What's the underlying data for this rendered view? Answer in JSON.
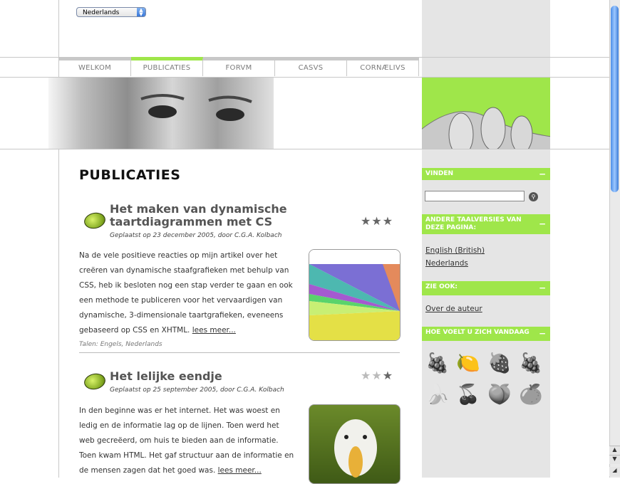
{
  "language_select": {
    "value": "Nederlands"
  },
  "nav": [
    {
      "label": "WELKOM",
      "active": false
    },
    {
      "label": "PUBLICATIES",
      "active": true
    },
    {
      "label": "FORVM",
      "active": false
    },
    {
      "label": "CASVS",
      "active": false
    },
    {
      "label": "CORNÆLIVS",
      "active": false
    }
  ],
  "page_title": "PUBLICATIES",
  "posts": [
    {
      "title": "Het maken van dynamische taartdiagrammen met CS",
      "meta": "Geplaatst op 23 december 2005, door C.G.A. Kolbach",
      "rating": 3,
      "body": "Na de vele positieve reacties op mijn artikel over het creëren van dynamische staafgrafieken met behulp van CSS, heb ik besloten nog een stap verder te gaan en ook een methode te publiceren voor het vervaardigen van dynamische, 3-dimensionale taartgrafieken, eveneens gebaseerd op CSS en XHTML.",
      "read_more": "lees meer...",
      "languages": "Talen: Engels, Nederlands"
    },
    {
      "title": "Het lelijke eendje",
      "meta": "Geplaatst op 25 september 2005, door C.G.A. Kolbach",
      "rating": 1,
      "body": "In den beginne was er het internet. Het was woest en ledig en de informatie lag op de lijnen. Toen werd het web gecreëerd, om huis te bieden aan de informatie. Toen kwam HTML. Het gaf structuur aan de informatie en de mensen zagen dat het goed was.",
      "read_more": "lees meer..."
    }
  ],
  "sidebar": {
    "find_heading": "VINDEN",
    "search": {
      "value": "",
      "icon": "search-icon"
    },
    "other_languages_heading": "ANDERE TAALVERSIES VAN DEZE PAGINA:",
    "other_languages": [
      "English (British)",
      "Nederlands"
    ],
    "see_also_heading": "ZIE OOK:",
    "see_also": [
      "Over de auteur"
    ],
    "mood_heading": "HOE VOELT U ZICH VANDAAG",
    "moods": [
      {
        "icon": "grapes-icon",
        "glyph": "🍇"
      },
      {
        "icon": "lime-icon",
        "glyph": "🍋"
      },
      {
        "icon": "strawberry-icon",
        "glyph": "🍓"
      },
      {
        "icon": "raspberry-icon",
        "glyph": "🍇"
      },
      {
        "icon": "banana-icon",
        "glyph": "🍌"
      },
      {
        "icon": "cherries-icon",
        "glyph": "🍒"
      },
      {
        "icon": "peach-icon",
        "glyph": "🍑"
      },
      {
        "icon": "grapefruit-icon",
        "glyph": "🍊"
      }
    ],
    "collapse_glyph": "−"
  },
  "colors": {
    "accent": "#9fe64a",
    "sidebar_bg": "#e5e5e5"
  }
}
